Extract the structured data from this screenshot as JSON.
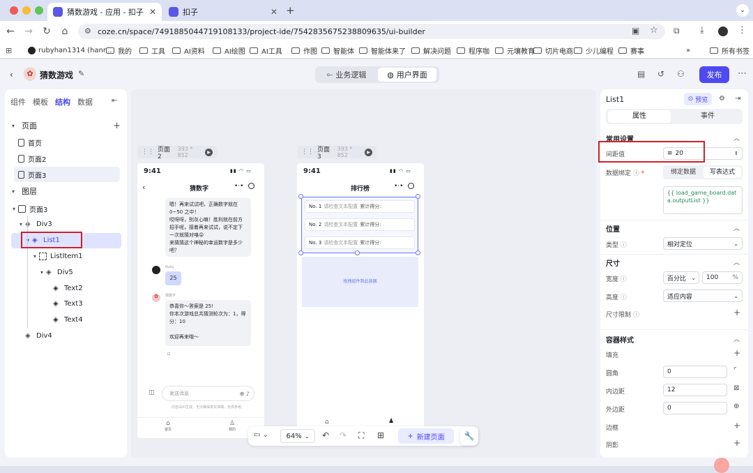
{
  "browser": {
    "tabs": [
      {
        "label": "猜数游戏 - 应用 - 扣子"
      },
      {
        "label": "扣子"
      }
    ],
    "url": "coze.cn/space/7491885044719108133/project-ide/7542835675238809635/ui-builder",
    "bookmarks": [
      "rubyhan1314 (hanr...",
      "我的",
      "工具",
      "AI资料",
      "AI绘图",
      "AI工具",
      "作图",
      "智能体",
      "智能体来了",
      "解决问题",
      "程序咖",
      "元壤教育",
      "切片电商",
      "少儿编程",
      "赛事"
    ],
    "bookmarks_more": "»",
    "all_bookmarks": "所有书签"
  },
  "header": {
    "project": "猜数游戏",
    "tab_logic": "业务逻辑",
    "tab_ui": "用户界面",
    "publish": "发布"
  },
  "left": {
    "tabs": [
      "组件",
      "模板",
      "结构",
      "数据"
    ],
    "pages_title": "页面",
    "pages": [
      "首页",
      "页面2",
      "页面3"
    ],
    "layers_title": "图层",
    "layers": [
      {
        "label": "页面3",
        "indent": 0
      },
      {
        "label": "Div3",
        "indent": 1
      },
      {
        "label": "List1",
        "indent": 2
      },
      {
        "label": "ListItem1",
        "indent": 3
      },
      {
        "label": "Div5",
        "indent": 4
      },
      {
        "label": "Text2",
        "indent": 5
      },
      {
        "label": "Text3",
        "indent": 5
      },
      {
        "label": "Text4",
        "indent": 5
      },
      {
        "label": "Div4",
        "indent": 1
      }
    ]
  },
  "canvas": {
    "page2": {
      "name": "页面2",
      "size": "393 * 852",
      "time": "9:41",
      "title": "猜数字",
      "bot_msg1": "嗯！再来试试吧，正确数字就在0~50 之中！\n哎呀呀，别灰心嘛！胜利就在前方招手呢，接着再来试试，说不定下一次就猜对咯😜\n来猜猜这个神秘的幸运数字是多少吧？",
      "user_name": "Ruby",
      "user_msg": "25",
      "bot_name": "猜数字",
      "bot_msg2": "恭喜你～答案是 25!\n你本次游戏总共猜测轮次为：1，得分：10\n\n欢迎再来哦～",
      "input_placeholder": "发送消息",
      "disclaimer": "内容由AI生成，无法确保真实准确，仅供参考。",
      "nav_home": "首页",
      "nav_mine": "我的"
    },
    "page3": {
      "name": "页面3",
      "size": "393 * 852",
      "time": "9:41",
      "title": "排行榜",
      "rows": [
        {
          "no": "No. 1",
          "hint": "请检查文本配置",
          "score": "累计得分:"
        },
        {
          "no": "No. 2",
          "hint": "请检查文本配置",
          "score": "累计得分:"
        },
        {
          "no": "No. 3",
          "hint": "请检查文本配置",
          "score": "累计得分:"
        }
      ],
      "drop_hint": "拖拽组件到此容器"
    },
    "zoom": "64%",
    "new_page": "新建页面"
  },
  "right": {
    "component": "List1",
    "preview": "预览",
    "tab_props": "属性",
    "tab_events": "事件",
    "common": "常用设置",
    "gap_label": "间距值",
    "gap_value": "20",
    "bind_label": "数据绑定",
    "bind_btn1": "绑定数据",
    "bind_btn2": "写表达式",
    "expression": "{{ load_game_board.data.outputList }}",
    "position": "位置",
    "type_label": "类型",
    "type_value": "相对定位",
    "size": "尺寸",
    "width_label": "宽度",
    "width_unit_select": "百分比",
    "width_value": "100",
    "width_unit": "%",
    "height_label": "高度",
    "height_value": "适应内容",
    "size_limit": "尺寸限制",
    "container": "容器样式",
    "fill": "填充",
    "radius_label": "圆角",
    "radius_value": "0",
    "padding_label": "内边距",
    "padding_value": "12",
    "margin_label": "外边距",
    "margin_value": "0",
    "border": "边框",
    "shadow": "阴影"
  }
}
